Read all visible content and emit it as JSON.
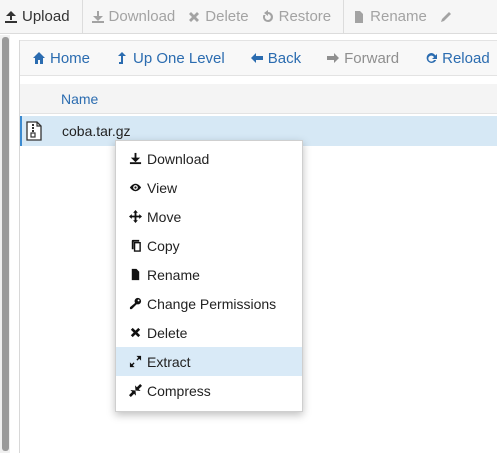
{
  "toolbar": {
    "items": [
      {
        "label": "Upload",
        "icon": "upload-icon",
        "enabled": true
      },
      {
        "label": "Download",
        "icon": "download-icon",
        "enabled": false
      },
      {
        "label": "Delete",
        "icon": "delete-icon",
        "enabled": false
      },
      {
        "label": "Restore",
        "icon": "restore-icon",
        "enabled": false
      },
      {
        "label": "Rename",
        "icon": "rename-icon",
        "enabled": false
      },
      {
        "label": "",
        "icon": "edit-icon",
        "enabled": false
      }
    ]
  },
  "navbar": {
    "home": "Home",
    "up": "Up One Level",
    "back": "Back",
    "forward": "Forward",
    "reload": "Reload"
  },
  "table": {
    "column_name": "Name",
    "rows": [
      {
        "name": "coba.tar.gz",
        "icon": "archive-file-icon",
        "selected": true
      }
    ]
  },
  "context_menu": {
    "items": [
      {
        "label": "Download",
        "icon": "download-icon"
      },
      {
        "label": "View",
        "icon": "eye-icon"
      },
      {
        "label": "Move",
        "icon": "move-icon"
      },
      {
        "label": "Copy",
        "icon": "copy-icon"
      },
      {
        "label": "Rename",
        "icon": "file-icon"
      },
      {
        "label": "Change Permissions",
        "icon": "key-icon"
      },
      {
        "label": "Delete",
        "icon": "close-icon"
      },
      {
        "label": "Extract",
        "icon": "expand-icon",
        "highlighted": true
      },
      {
        "label": "Compress",
        "icon": "compress-icon"
      }
    ]
  },
  "colors": {
    "link_blue": "#2b6cb0",
    "selected_row": "#d6e8f5",
    "menu_highlight": "#d9eaf7"
  }
}
